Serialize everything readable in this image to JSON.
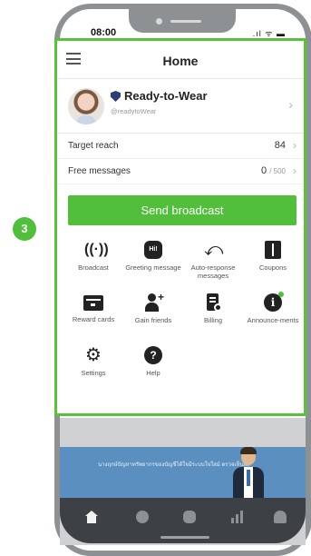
{
  "status_bar": {
    "time": "08:00",
    "icons_text": ".ıl ᯤ ▬"
  },
  "step_badge": "3",
  "header": {
    "title": "Home"
  },
  "account": {
    "name": "Ready-to-Wear",
    "id": "@readytoWear"
  },
  "stats": {
    "target_reach_label": "Target reach",
    "target_reach_value": "84",
    "free_messages_label": "Free messages",
    "free_messages_used": "0",
    "free_messages_total": "/ 500"
  },
  "broadcast_button": "Send broadcast",
  "menu": {
    "broadcast": "Broadcast",
    "greeting": "Greeting message",
    "auto_response": "Auto-response messages",
    "coupons": "Coupons",
    "reward_cards": "Reward cards",
    "gain_friends": "Gain friends",
    "billing": "Billing",
    "announcements": "Announce-ments",
    "settings": "Settings",
    "help": "Help"
  },
  "icons": {
    "greeting_glyph": "Hi!",
    "info_glyph": "i",
    "help_glyph": "?"
  },
  "banner": {
    "text": "นางฤกษ์ปัญหาทรัพยากรของบัญชีได้ใจมีระบบใจใสม์ ตรวจเห็นผล"
  },
  "colors": {
    "accent": "#52bf3c",
    "nav_bg": "#3d4146",
    "frame": "#8d9194",
    "banner": "#5b8fbf"
  }
}
